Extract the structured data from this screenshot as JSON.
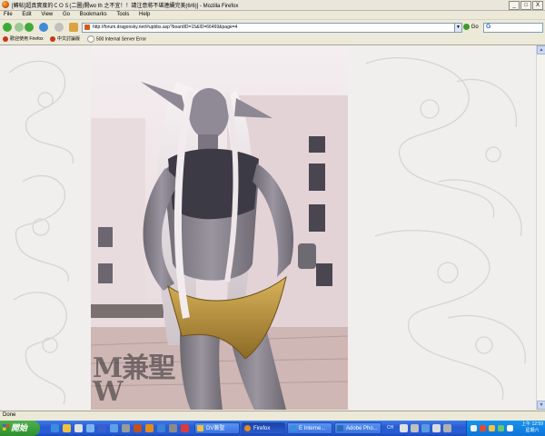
{
  "window": {
    "title": "[轉帖]超真實度的ＣＯＳ(二圖)開wo th 之不宜！！請注意將不堪連續完美(6/6)] - Mozilla Firefox",
    "min": "_",
    "max": "□",
    "close": "X"
  },
  "menu": [
    "File",
    "Edit",
    "View",
    "Go",
    "Bookmarks",
    "Tools",
    "Help"
  ],
  "nav": {
    "url": "http://forum.dragonsky.net/#upbbs.asp?boardID=15&ID=66469&page=4",
    "go_label": "Go"
  },
  "bookmarks": [
    "歡迎使用 Firefox",
    "中文討論版",
    "500 Internal Server Error"
  ],
  "photo": {
    "watermark_top": "M兼聖",
    "watermark_bottom": "W"
  },
  "status": {
    "text": "Done"
  },
  "taskbar": {
    "start": "開始",
    "buttons": [
      "DV兼聖",
      "Firefox",
      "E Interne...",
      "Adobe Pho..."
    ],
    "tray": {
      "lang": "CH",
      "time": "上午 12:59",
      "day": "星期六"
    }
  },
  "colors": {
    "page_bg": "#f1eeee",
    "taskbar": "#245dd7",
    "tray": "#0e74d8"
  }
}
